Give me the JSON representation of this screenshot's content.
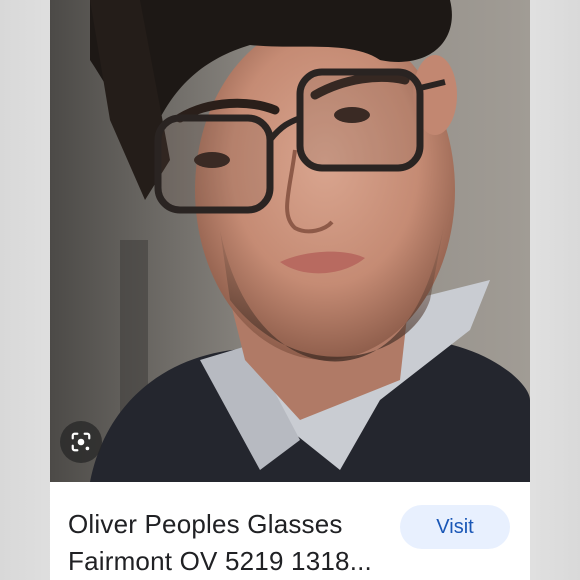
{
  "result_card": {
    "title_line_1": "Oliver Peoples Glasses",
    "title_line_2": "Fairmont OV 5219 1318...",
    "visit_label": "Visit"
  },
  "icons": {
    "lens": "google-lens-icon"
  },
  "colors": {
    "visit_background": "#e8f0fe",
    "visit_text": "#1a57b6",
    "title_text": "#202124"
  }
}
